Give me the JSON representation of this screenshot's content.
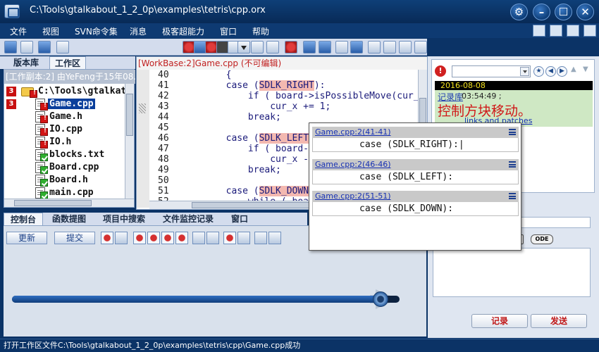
{
  "window": {
    "title": "C:\\Tools\\gtalkabout_1_2_0p\\examples\\tetris\\cpp.orx",
    "controls": [
      "settings-gear",
      "minimize",
      "maximize",
      "close"
    ]
  },
  "menu": [
    "文件",
    "视图",
    "SVN命令集",
    "消息",
    "极客超能力",
    "窗口",
    "帮助"
  ],
  "left_tabs": [
    "版本库",
    "工作区"
  ],
  "tree": {
    "header": "[工作副本:2] 由YeFeng于15年08...",
    "items": [
      {
        "badge": "3",
        "label": "C:\\Tools\\gtalkat",
        "type": "folder",
        "status": "error"
      },
      {
        "badge": "3",
        "label": "Game.cpp",
        "type": "file",
        "status": "error",
        "selected": true
      },
      {
        "label": "Game.h",
        "type": "file",
        "status": "error"
      },
      {
        "label": "IO.cpp",
        "type": "file",
        "status": "error"
      },
      {
        "label": "IO.h",
        "type": "file",
        "status": "error"
      },
      {
        "label": "blocks.txt",
        "type": "file",
        "status": "ok"
      },
      {
        "label": "Board.cpp",
        "type": "file",
        "status": "ok"
      },
      {
        "label": "Board.h",
        "type": "file",
        "status": "ok"
      },
      {
        "label": "main.cpp",
        "type": "file",
        "status": "ok"
      }
    ]
  },
  "editor": {
    "header": "[WorkBase:2]Game.cpp (不可编辑)",
    "lines": [
      {
        "no": "40",
        "code": "        {"
      },
      {
        "no": "41",
        "code": "        case (SDLK_RIGHT):",
        "hl": "SDLK_RIGHT"
      },
      {
        "no": "42",
        "code": "            if ( board->isPossibleMove(cur_x"
      },
      {
        "no": "43",
        "code": "                cur_x += 1;"
      },
      {
        "no": "44",
        "code": "            break;"
      },
      {
        "no": "45",
        "code": ""
      },
      {
        "no": "46",
        "code": "        case (SDLK_LEFT):",
        "hl": "SDLK_LEFT"
      },
      {
        "no": "47",
        "code": "            if ( board->i"
      },
      {
        "no": "48",
        "code": "                cur_x -="
      },
      {
        "no": "49",
        "code": "            break;"
      },
      {
        "no": "50",
        "code": ""
      },
      {
        "no": "51",
        "code": "        case (SDLK_DOWN):",
        "hl": "SDLK_DOWN"
      },
      {
        "no": "52",
        "code": "            while ( board"
      }
    ]
  },
  "popup": {
    "entries": [
      {
        "link": "Game.cpp:2(41-41)",
        "code": "case (SDLK_RIGHT):|"
      },
      {
        "link": "Game.cpp:2(46-46)",
        "code": "case (SDLK_LEFT):"
      },
      {
        "link": "Game.cpp:2(51-51)",
        "code": "case (SDLK_DOWN):"
      }
    ]
  },
  "right_panel": {
    "date": "2016-08-08",
    "repo_label": "记录库",
    "time": "03:54:49 ;",
    "message": "控制方块移动。",
    "link": "links and patches",
    "buttons": {
      "record": "记录",
      "send": "发送"
    },
    "icon_label": "ODE"
  },
  "console": {
    "tabs": [
      "控制台",
      "函数提图",
      "项目中搜索",
      "文件监控记录",
      "窗口"
    ],
    "buttons": {
      "refresh": "更新",
      "submit": "提交"
    },
    "progress": 0.95
  },
  "status": "打开工作区文件C:\\Tools\\gtalkabout_1_2_0p\\examples\\tetris\\cpp\\Game.cpp成功",
  "colors": {
    "accent": "#0b3366",
    "error": "#c81010",
    "ok": "#2fae2f",
    "highlight": "#f3b8b0"
  }
}
